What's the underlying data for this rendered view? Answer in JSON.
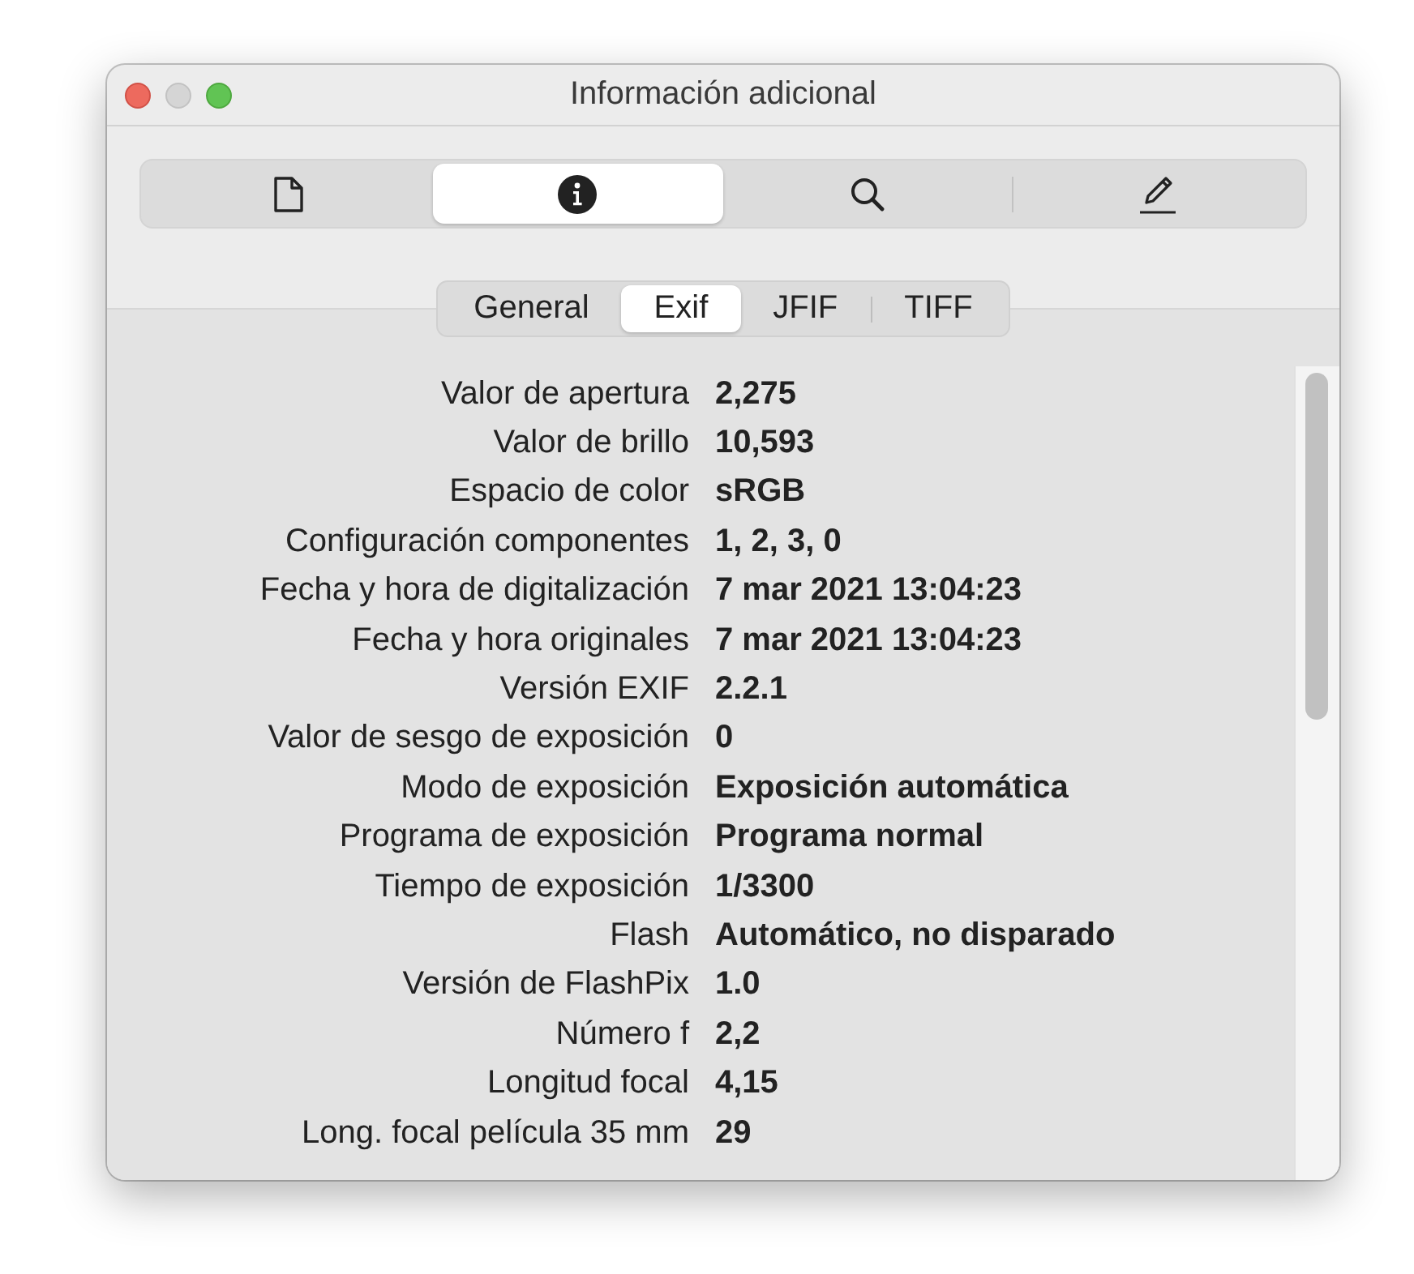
{
  "window": {
    "title": "Información adicional"
  },
  "toolbar": [
    {
      "kind": "document",
      "selected": false
    },
    {
      "kind": "info",
      "selected": true
    },
    {
      "kind": "search",
      "selected": false
    },
    {
      "kind": "edit",
      "selected": false
    }
  ],
  "tabs": [
    {
      "label": "General",
      "selected": false
    },
    {
      "label": "Exif",
      "selected": true
    },
    {
      "label": "JFIF",
      "selected": false
    },
    {
      "label": "TIFF",
      "selected": false
    }
  ],
  "rows": [
    {
      "label": "Valor de apertura",
      "value": "2,275"
    },
    {
      "label": "Valor de brillo",
      "value": "10,593"
    },
    {
      "label": "Espacio de color",
      "value": "sRGB"
    },
    {
      "label": "Configuración componentes",
      "value": "1, 2, 3, 0"
    },
    {
      "label": "Fecha y hora de digitalización",
      "value": "7 mar 2021 13:04:23"
    },
    {
      "label": "Fecha y hora originales",
      "value": "7 mar 2021 13:04:23"
    },
    {
      "label": "Versión EXIF",
      "value": "2.2.1"
    },
    {
      "label": "Valor de sesgo de exposición",
      "value": "0"
    },
    {
      "label": "Modo de exposición",
      "value": "Exposición automática"
    },
    {
      "label": "Programa de exposición",
      "value": "Programa normal"
    },
    {
      "label": "Tiempo de exposición",
      "value": "1/3300"
    },
    {
      "label": "Flash",
      "value": "Automático, no disparado"
    },
    {
      "label": "Versión de FlashPix",
      "value": "1.0"
    },
    {
      "label": "Número f",
      "value": "2,2"
    },
    {
      "label": "Longitud focal",
      "value": "4,15"
    },
    {
      "label": "Long. focal película 35 mm",
      "value": "29"
    }
  ]
}
